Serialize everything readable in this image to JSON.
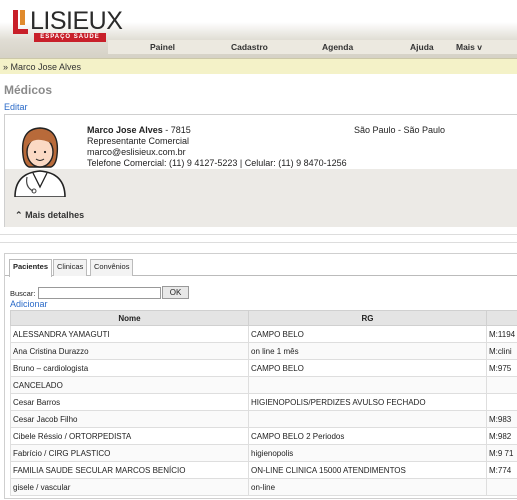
{
  "header": {
    "logo_name": "LISIEUX",
    "logo_sub": "ESPAÇO SAÚDE",
    "nav": [
      "Painel",
      "Cadastro",
      "Agenda",
      "Ajuda",
      "Mais v"
    ]
  },
  "breadcrumb": "» Marco Jose Alves",
  "page_title": "Médicos",
  "edit_label": "Editar",
  "doctor": {
    "name": "Marco Jose Alves",
    "code": " - 7815",
    "role": "Representante Comercial",
    "email": "marco@eslisieux.com.br",
    "phone": "Telefone Comercial: (11) 9 4127-5223 | Celular: (11) 9 8470-1256",
    "location": "São Paulo - São Paulo",
    "more_details": "Mais detalhes"
  },
  "tabs": [
    "Pacientes",
    "Clinicas",
    "Convênios"
  ],
  "search": {
    "label": "Buscar:",
    "button": "OK"
  },
  "add_label": "Adicionar",
  "table": {
    "headers": [
      "Nome",
      "RG",
      ""
    ],
    "rows": [
      [
        "ALESSANDRA YAMAGUTI",
        "CAMPO BELO",
        "M:1194"
      ],
      [
        "Ana Cristina Durazzo",
        "on line 1 mês",
        "M:clini"
      ],
      [
        "Bruno – cardiologista",
        "CAMPO BELO",
        "M:975"
      ],
      [
        "CANCELADO",
        "",
        ""
      ],
      [
        "Cesar Barros",
        "HIGIENOPOLIS/PERDIZES AVULSO FECHADO",
        ""
      ],
      [
        "Cesar Jacob Filho",
        "",
        "M:983"
      ],
      [
        "Cibele Réssio / ORTORPEDISTA",
        "CAMPO BELO 2 Periodos",
        "M:982"
      ],
      [
        "Fabrício / CIRG PLASTICO",
        "higienopolis",
        "M:9 71"
      ],
      [
        "FAMILIA SAUDE SECULAR MARCOS BENÍCIO",
        "ON-LINE CLINICA 15000 ATENDIMENTOS",
        "M:774"
      ],
      [
        "gisele / vascular",
        "on-line",
        ""
      ]
    ]
  }
}
